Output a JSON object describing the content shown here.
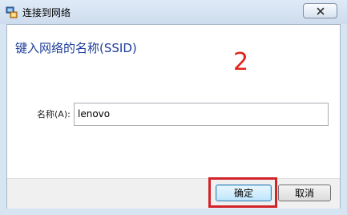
{
  "window": {
    "title": "连接到网络",
    "close_icon": "close-icon",
    "app_icon": "network-icon"
  },
  "dialog": {
    "heading": "键入网络的名称(SSID)",
    "annotation": "2",
    "name_label": "名称(A):",
    "name_value": "lenovo"
  },
  "buttons": {
    "ok_label": "确定",
    "cancel_label": "取消"
  },
  "colors": {
    "heading": "#1e3e9a",
    "annotation": "#e2231a",
    "highlight": "#d2232a"
  }
}
